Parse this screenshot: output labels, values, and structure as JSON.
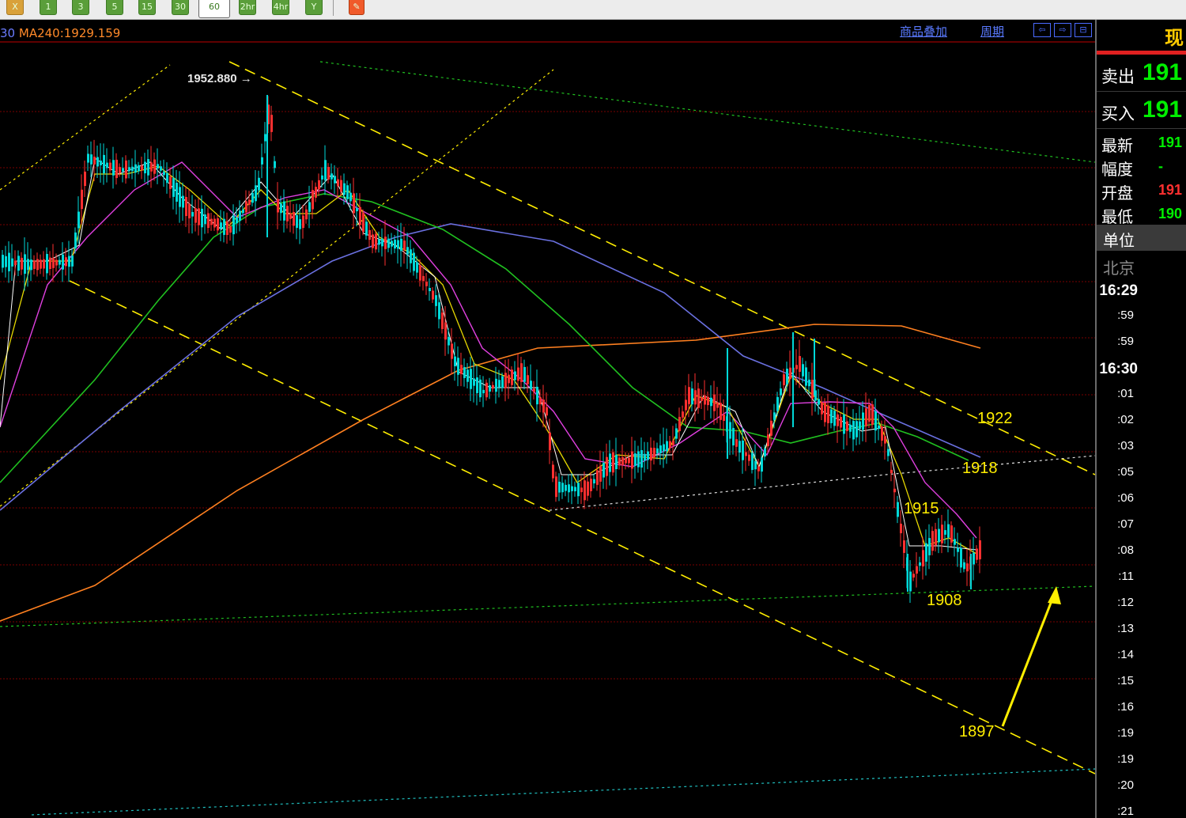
{
  "toolbar": {
    "buttons": [
      {
        "label": "X",
        "name": "period-x-button"
      },
      {
        "label": "1",
        "name": "period-1-button"
      },
      {
        "label": "3",
        "name": "period-3-button"
      },
      {
        "label": "5",
        "name": "period-5-button"
      },
      {
        "label": "15",
        "name": "period-15-button"
      },
      {
        "label": "30",
        "name": "period-30-button"
      },
      {
        "label": "60",
        "name": "period-60-button",
        "active": true
      },
      {
        "label": "2hr",
        "name": "period-2hr-button"
      },
      {
        "label": "4hr",
        "name": "period-4hr-button"
      },
      {
        "label": "Y",
        "name": "period-y-button"
      }
    ],
    "draw_icon": "pencil-draw-icon"
  },
  "chart": {
    "ma_prefix": "30",
    "ma_label": "MA240:1929.159",
    "peak_label": "1952.880",
    "overlay_link": "商品叠加",
    "period_link": "周期",
    "nav_icons": [
      "⇦",
      "⇨",
      "⊟"
    ],
    "annotations": {
      "a1922": "1922",
      "a1918": "1918",
      "a1915": "1915",
      "a1908": "1908",
      "a1897": "1897"
    },
    "colors": {
      "background": "#000000",
      "up_candle": "#ff3030",
      "down_candle": "#00d8d8",
      "ma_short": "#ffffff",
      "ma_yellow": "#e6d800",
      "ma_magenta": "#e040e0",
      "ma_green": "#20c020",
      "ma_blue": "#6a70e0",
      "ma_orange": "#ff8020",
      "trendline": "#ffee00",
      "grid": "#7a0000"
    }
  },
  "side": {
    "title": "现",
    "sell_label": "卖出",
    "sell_value": "191",
    "buy_label": "买入",
    "buy_value": "191",
    "stats": [
      {
        "label": "最新",
        "value": "191",
        "color": "#00ee00"
      },
      {
        "label": "幅度",
        "value": "-",
        "color": "#00ee00"
      },
      {
        "label": "开盘",
        "value": "191",
        "color": "#ff3030"
      },
      {
        "label": "最低",
        "value": "190",
        "color": "#00ee00"
      }
    ],
    "unit_label": "单位",
    "city_label": "北京",
    "times": [
      "16:29",
      ":59",
      ":59",
      "16:30",
      ":01",
      ":02",
      ":03",
      ":05",
      ":06",
      ":07",
      ":08",
      ":11",
      ":12",
      ":13",
      ":14",
      ":15",
      ":16",
      ":19",
      ":19",
      ":20",
      ":21"
    ]
  }
}
